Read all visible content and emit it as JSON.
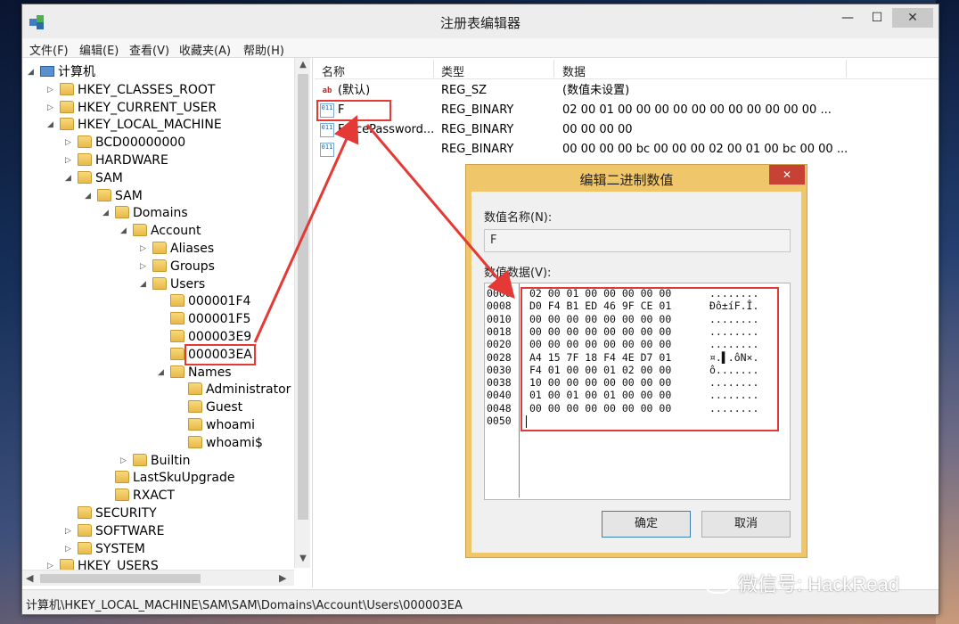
{
  "window": {
    "title": "注册表编辑器",
    "minimize": "—",
    "maximize": "☐",
    "close": "✕"
  },
  "menu": [
    "文件(F)",
    "编辑(E)",
    "查看(V)",
    "收藏夹(A)",
    "帮助(H)"
  ],
  "tree": {
    "nodes": [
      {
        "label": "计算机",
        "expander": "◢",
        "icon": "computer-icon"
      },
      {
        "label": "HKEY_CLASSES_ROOT",
        "expander": "▷"
      },
      {
        "label": "HKEY_CURRENT_USER",
        "expander": "▷"
      },
      {
        "label": "HKEY_LOCAL_MACHINE",
        "expander": "◢"
      },
      {
        "label": "BCD00000000",
        "expander": "▷"
      },
      {
        "label": "HARDWARE",
        "expander": "▷"
      },
      {
        "label": "SAM",
        "expander": "◢"
      },
      {
        "label": "SAM",
        "expander": "◢"
      },
      {
        "label": "Domains",
        "expander": "◢"
      },
      {
        "label": "Account",
        "expander": "◢"
      },
      {
        "label": "Aliases",
        "expander": "▷"
      },
      {
        "label": "Groups",
        "expander": "▷"
      },
      {
        "label": "Users",
        "expander": "◢"
      },
      {
        "label": "000001F4",
        "expander": ""
      },
      {
        "label": "000001F5",
        "expander": ""
      },
      {
        "label": "000003E9",
        "expander": ""
      },
      {
        "label": "000003EA",
        "expander": "",
        "selected": true
      },
      {
        "label": "Names",
        "expander": "◢"
      },
      {
        "label": "Administrator",
        "expander": ""
      },
      {
        "label": "Guest",
        "expander": ""
      },
      {
        "label": "whoami",
        "expander": ""
      },
      {
        "label": "whoami$",
        "expander": ""
      },
      {
        "label": "Builtin",
        "expander": "▷"
      },
      {
        "label": "LastSkuUpgrade",
        "expander": ""
      },
      {
        "label": "RXACT",
        "expander": ""
      },
      {
        "label": "SECURITY",
        "expander": ""
      },
      {
        "label": "SOFTWARE",
        "expander": "▷"
      },
      {
        "label": "SYSTEM",
        "expander": "▷"
      },
      {
        "label": "HKEY_USERS",
        "expander": "▷"
      }
    ]
  },
  "list": {
    "headers": {
      "name": "名称",
      "type": "类型",
      "data": "数据"
    },
    "rows": [
      {
        "icon": "ab",
        "name": "(默认)",
        "type": "REG_SZ",
        "data": "(数值未设置)"
      },
      {
        "icon": "011",
        "name": "F",
        "type": "REG_BINARY",
        "data": "02 00 01 00 00 00 00 00 00 00 00 00 00 00 ..."
      },
      {
        "icon": "011",
        "name": "ForcePassword...",
        "type": "REG_BINARY",
        "data": "00 00 00 00"
      },
      {
        "icon": "011",
        "name": "",
        "type": "REG_BINARY",
        "data": "00 00 00 00 bc 00 00 00 02 00 01 00 bc 00 00 ..."
      }
    ]
  },
  "statusbar": "计算机\\HKEY_LOCAL_MACHINE\\SAM\\SAM\\Domains\\Account\\Users\\000003EA",
  "dialog": {
    "title": "编辑二进制数值",
    "close": "✕",
    "name_label": "数值名称(N):",
    "name_value": "F",
    "data_label": "数值数据(V):",
    "hex": [
      {
        "offset": "0000",
        "bytes": "02 00 01 00 00 00 00 00",
        "ascii": "........"
      },
      {
        "offset": "0008",
        "bytes": "D0 F4 B1 ED 46 9F CE 01",
        "ascii": "Ðô±íF.Î."
      },
      {
        "offset": "0010",
        "bytes": "00 00 00 00 00 00 00 00",
        "ascii": "........"
      },
      {
        "offset": "0018",
        "bytes": "00 00 00 00 00 00 00 00",
        "ascii": "........"
      },
      {
        "offset": "0020",
        "bytes": "00 00 00 00 00 00 00 00",
        "ascii": "........"
      },
      {
        "offset": "0028",
        "bytes": "A4 15 7F 18 F4 4E D7 01",
        "ascii": "¤.▌.ôN×."
      },
      {
        "offset": "0030",
        "bytes": "F4 01 00 00 01 02 00 00",
        "ascii": "ô......."
      },
      {
        "offset": "0038",
        "bytes": "10 00 00 00 00 00 00 00",
        "ascii": "........"
      },
      {
        "offset": "0040",
        "bytes": "01 00 01 00 01 00 00 00",
        "ascii": "........"
      },
      {
        "offset": "0048",
        "bytes": "00 00 00 00 00 00 00 00",
        "ascii": "........"
      },
      {
        "offset": "0050",
        "bytes": "",
        "ascii": ""
      }
    ],
    "ok": "确定",
    "cancel": "取消"
  },
  "watermark": "微信号: HackRead",
  "colors": {
    "annotation": "#e53935",
    "dialog_frame": "#f0c66a",
    "close": "#c74134"
  }
}
